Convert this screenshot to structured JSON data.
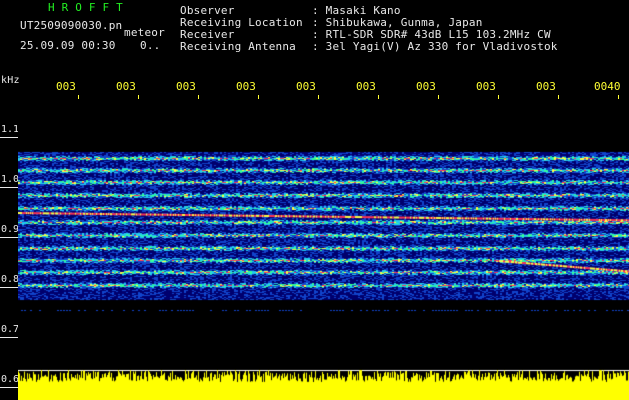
{
  "header": {
    "logo": "HROFFT",
    "filename": "UT2509090030.pn",
    "meteor": "meteor",
    "datetime": "25.09.09 00:30",
    "count": "0.."
  },
  "info": [
    {
      "label": "Observer",
      "value": ": Masaki Kano"
    },
    {
      "label": "Receiving Location",
      "value": ": Shibukawa, Gunma, Japan"
    },
    {
      "label": "Receiver",
      "value": ": RTL-SDR SDR# 43dB L15 103.2MHz CW"
    },
    {
      "label": "Receiving Antenna",
      "value": ": 3el Yagi(V) Az 330 for Vladivostok"
    }
  ],
  "axis": {
    "unit": "kHz",
    "y_ticks": [
      "1.1",
      "1.0",
      "0.9",
      "0.8",
      "0.7",
      "0.6"
    ],
    "time_ticks": [
      "003",
      "003",
      "003",
      "003",
      "003",
      "003",
      "003",
      "003",
      "003",
      "0040"
    ]
  },
  "colors": {
    "text": "#e8e8e8",
    "logo": "#22ee22",
    "time_labels": "#ffff33",
    "background_noise": "#00006e",
    "signal": "#ff3355",
    "baseline": "#ffff00"
  }
}
